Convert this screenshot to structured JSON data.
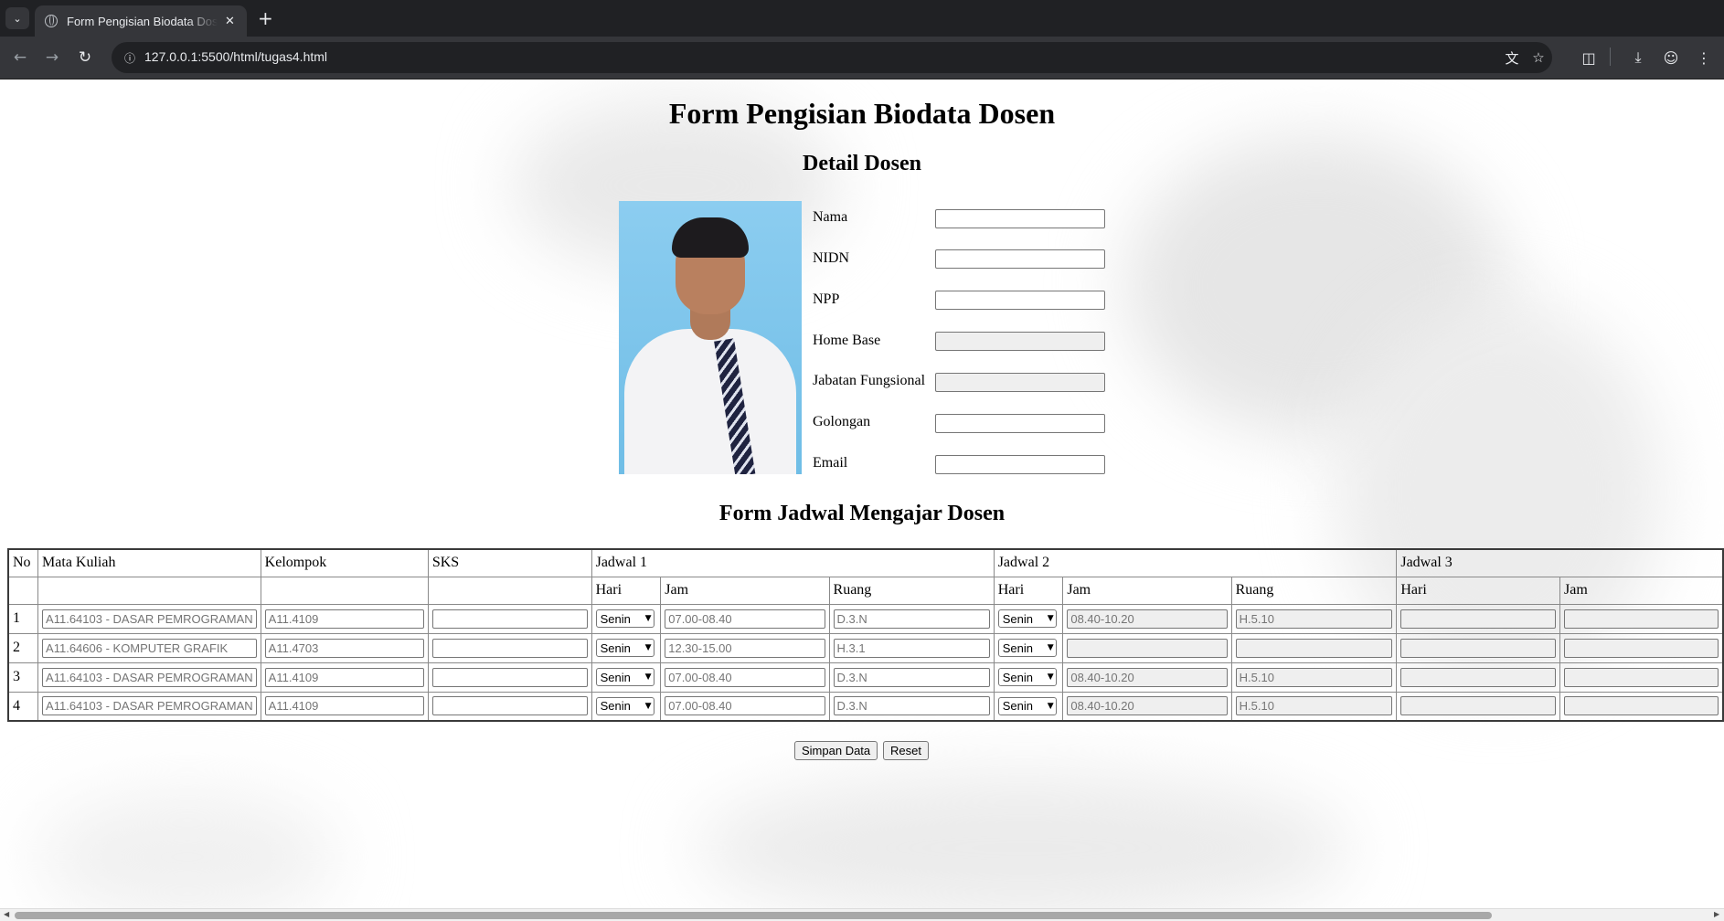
{
  "browser": {
    "tab_title": "Form Pengisian Biodata Dosen",
    "url": "127.0.0.1:5500/html/tugas4.html"
  },
  "page": {
    "title": "Form Pengisian Biodata Dosen",
    "detail_heading": "Detail Dosen",
    "schedule_heading": "Form Jadwal Mengajar Dosen"
  },
  "bio_fields": [
    {
      "label": "Nama",
      "value": ""
    },
    {
      "label": "NIDN",
      "value": ""
    },
    {
      "label": "NPP",
      "value": ""
    },
    {
      "label": "Home Base",
      "value": ""
    },
    {
      "label": "Jabatan Fungsional",
      "value": ""
    },
    {
      "label": "Golongan",
      "value": ""
    },
    {
      "label": "Email",
      "value": ""
    }
  ],
  "table": {
    "headers": [
      "No",
      "Mata Kuliah",
      "Kelompok",
      "SKS",
      "Jadwal 1",
      "Jadwal 2",
      "Jadwal 3"
    ],
    "sub_headers": [
      "Hari",
      "Jam",
      "Ruang"
    ],
    "rows": [
      {
        "no": "1",
        "mk": "A11.64103 - DASAR PEMROGRAMAN",
        "kel": "A11.4109",
        "sks": "",
        "j1_hari": "Senin",
        "j1_jam": "07.00-08.40",
        "j1_ruang": "D.3.N",
        "j2_hari": "Senin",
        "j2_jam": "08.40-10.20",
        "j2_ruang": "H.5.10",
        "j3_hari": "",
        "j3_jam": ""
      },
      {
        "no": "2",
        "mk": "A11.64606 - KOMPUTER GRAFIK",
        "kel": "A11.4703",
        "sks": "",
        "j1_hari": "Senin",
        "j1_jam": "12.30-15.00",
        "j1_ruang": "H.3.1",
        "j2_hari": "Senin",
        "j2_jam": "",
        "j2_ruang": "",
        "j3_hari": "",
        "j3_jam": ""
      },
      {
        "no": "3",
        "mk": "A11.64103 - DASAR PEMROGRAMAN",
        "kel": "A11.4109",
        "sks": "",
        "j1_hari": "Senin",
        "j1_jam": "07.00-08.40",
        "j1_ruang": "D.3.N",
        "j2_hari": "Senin",
        "j2_jam": "08.40-10.20",
        "j2_ruang": "H.5.10",
        "j3_hari": "",
        "j3_jam": ""
      },
      {
        "no": "4",
        "mk": "A11.64103 - DASAR PEMROGRAMAN",
        "kel": "A11.4109",
        "sks": "",
        "j1_hari": "Senin",
        "j1_jam": "07.00-08.40",
        "j1_ruang": "D.3.N",
        "j2_hari": "Senin",
        "j2_jam": "08.40-10.20",
        "j2_ruang": "H.5.10",
        "j3_hari": "",
        "j3_jam": ""
      }
    ]
  },
  "buttons": {
    "save": "Simpan Data",
    "reset": "Reset"
  },
  "colors": {
    "chrome_dark": "#202124",
    "chrome_toolbar": "#35363a",
    "disabled_input": "#efefef"
  }
}
